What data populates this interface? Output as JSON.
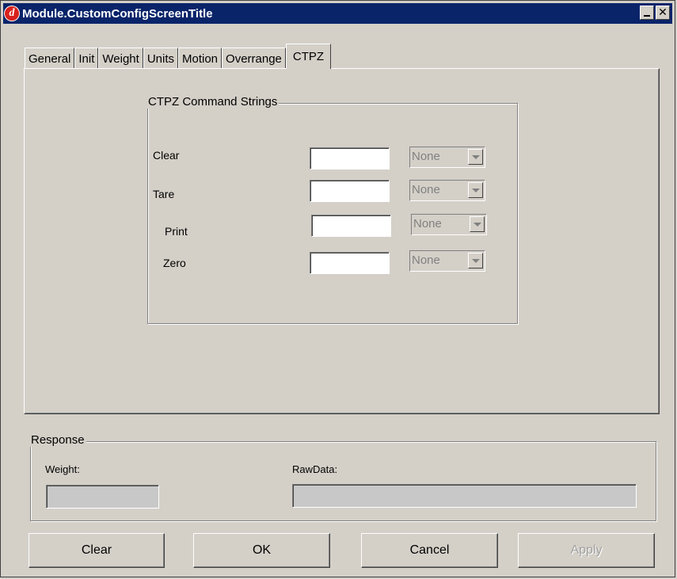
{
  "window": {
    "title": "Module.CustomConfigScreenTitle"
  },
  "titlebar": {
    "min_glyph": "",
    "close_glyph": "✕"
  },
  "tabs": [
    {
      "label": "General"
    },
    {
      "label": "Init"
    },
    {
      "label": "Weight"
    },
    {
      "label": "Units"
    },
    {
      "label": "Motion"
    },
    {
      "label": "Overrange"
    },
    {
      "label": "CTPZ"
    }
  ],
  "active_tab": "CTPZ",
  "ctpz": {
    "legend": "CTPZ Command Strings",
    "rows": [
      {
        "label": "Clear",
        "value": "",
        "option": "None"
      },
      {
        "label": "Tare",
        "value": "",
        "option": "None"
      },
      {
        "label": "Print",
        "value": "",
        "option": "None"
      },
      {
        "label": "Zero",
        "value": "",
        "option": "None"
      }
    ]
  },
  "response": {
    "legend": "Response",
    "weight_label": "Weight:",
    "weight_value": "",
    "rawdata_label": "RawData:",
    "rawdata_value": ""
  },
  "buttons": {
    "clear": "Clear",
    "ok": "OK",
    "cancel": "Cancel",
    "apply": "Apply"
  }
}
